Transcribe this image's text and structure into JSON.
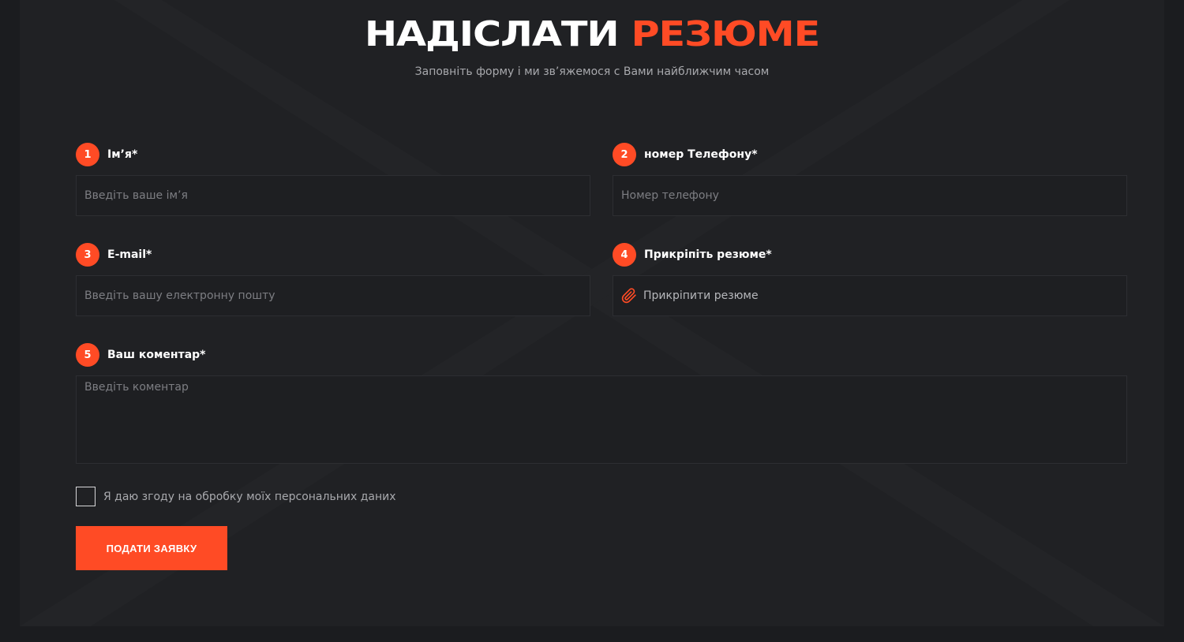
{
  "header": {
    "title_main": "НАДІСЛАТИ",
    "title_accent": "РЕЗЮМЕ",
    "subtitle": "Заповніть форму і ми зв’яжемося с Вами найближчим часом"
  },
  "fields": {
    "name": {
      "number": "1",
      "label": "Ім’я*",
      "placeholder": "Введіть ваше ім’я"
    },
    "phone": {
      "number": "2",
      "label": "номер Телефону*",
      "placeholder": "Номер телефону"
    },
    "email": {
      "number": "3",
      "label": "E-mail*",
      "placeholder": "Введіть вашу електронну пошту"
    },
    "resume": {
      "number": "4",
      "label": "Прикріпіть резюме*",
      "button_text": "Прикріпити резюме",
      "icon": "paperclip-icon"
    },
    "comment": {
      "number": "5",
      "label": "Ваш коментар*",
      "placeholder": "Введіть коментар"
    }
  },
  "consent": {
    "text": "Я даю згоду на обробку моїх персональних даних",
    "checked": false
  },
  "submit": {
    "label": "ПОДАТИ ЗАЯВКУ"
  },
  "colors": {
    "accent": "#ff4b25",
    "background": "#202124",
    "text": "#ffffff",
    "muted": "#a8a9ad"
  }
}
